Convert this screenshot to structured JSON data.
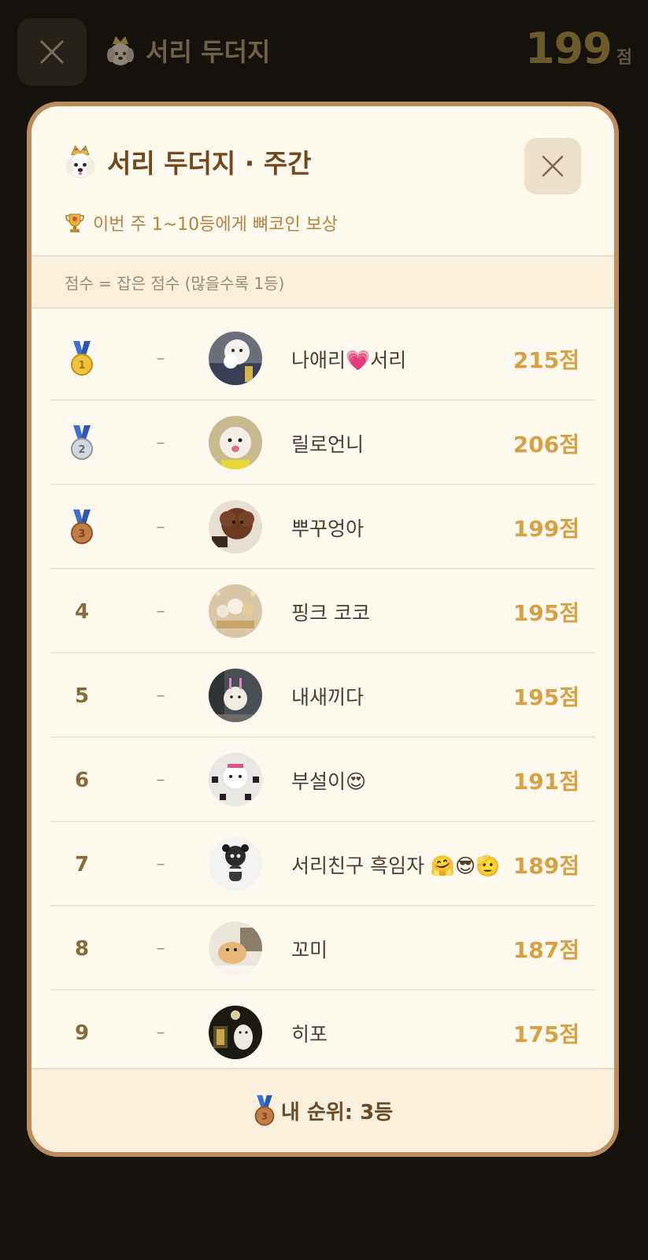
{
  "topbar": {
    "title": "서리 두더지",
    "score": "199",
    "score_unit": "점",
    "title_icon": "crowned-dog-icon",
    "close_icon": "close-icon"
  },
  "modal": {
    "title": "서리 두더지 · 주간",
    "title_icon": "crowned-dog-icon",
    "close_icon": "close-icon",
    "reward_text": "이번 주 1~10등에게 뼈코인 보상",
    "reward_icon": "trophy-icon",
    "info_text": "점수 = 잡은 점수 (많을수록 1등)"
  },
  "leaderboard": [
    {
      "rank": "1",
      "rank_icon": "gold-medal-icon",
      "change": "–",
      "name": "나애리💗서리",
      "score": "215점"
    },
    {
      "rank": "2",
      "rank_icon": "silver-medal-icon",
      "change": "–",
      "name": "릴로언니",
      "score": "206점"
    },
    {
      "rank": "3",
      "rank_icon": "bronze-medal-icon",
      "change": "–",
      "name": "뿌꾸엉아",
      "score": "199점"
    },
    {
      "rank": "4",
      "rank_icon": "",
      "change": "–",
      "name": "핑크 코코",
      "score": "195점"
    },
    {
      "rank": "5",
      "rank_icon": "",
      "change": "–",
      "name": "내새끼다",
      "score": "195점"
    },
    {
      "rank": "6",
      "rank_icon": "",
      "change": "–",
      "name": "부설이😍",
      "score": "191점"
    },
    {
      "rank": "7",
      "rank_icon": "",
      "change": "–",
      "name": "서리친구 흑임자 🤗😎🫡",
      "score": "189점"
    },
    {
      "rank": "8",
      "rank_icon": "",
      "change": "–",
      "name": "꼬미",
      "score": "187점"
    },
    {
      "rank": "9",
      "rank_icon": "",
      "change": "–",
      "name": "히포",
      "score": "175점"
    }
  ],
  "footer": {
    "my_rank_text": "내 순위: 3등",
    "icon": "bronze-medal-icon"
  },
  "colors": {
    "accent_score": "#d8a042",
    "modal_border": "#bd8c5c",
    "title_brown": "#75461a"
  }
}
